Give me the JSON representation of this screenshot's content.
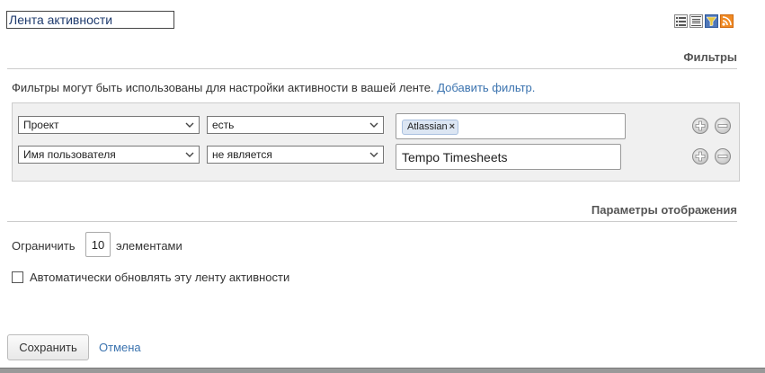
{
  "gadget": {
    "title_value": "Лента активности",
    "toolbar_icons": [
      "list-icon",
      "detail-list-icon",
      "filter-icon",
      "rss-icon"
    ],
    "colors": {
      "link": "#3b73af",
      "rss": "#f08a24"
    }
  },
  "filters": {
    "heading": "Фильтры",
    "description": "Фильтры могут быть использованы для настройки активности в вашей ленте.",
    "add_filter_link": "Добавить фильтр.",
    "rows": [
      {
        "field": "Проект",
        "operator": "есть",
        "tag": "Atlassian",
        "tag_remove": "×"
      },
      {
        "field": "Имя пользователя",
        "operator": "не является",
        "value": "Tempo Timesheets"
      }
    ]
  },
  "display": {
    "heading": "Параметры отображения",
    "limit_prefix": "Ограничить",
    "limit_value": "10",
    "limit_suffix": "элементами",
    "auto_refresh_label": "Автоматически обновлять эту ленту активности",
    "auto_refresh_checked": false
  },
  "actions": {
    "save_label": "Сохранить",
    "cancel_label": "Отмена"
  }
}
